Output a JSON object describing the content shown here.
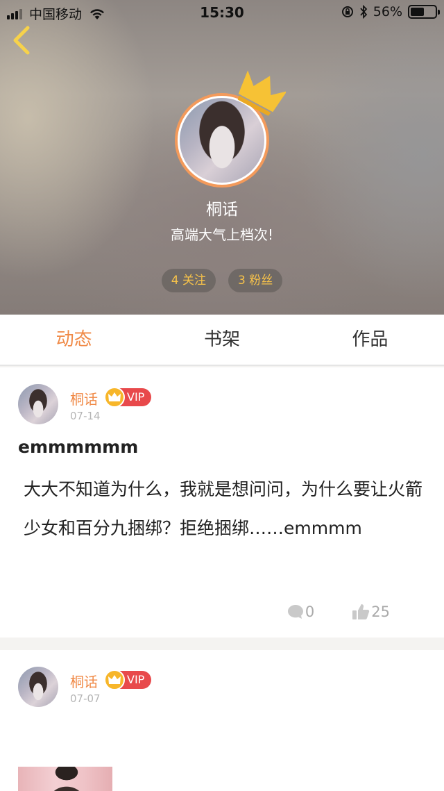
{
  "status_bar": {
    "carrier": "中国移动",
    "time": "15:30",
    "battery_percent": "56%",
    "battery_level": 0.56
  },
  "profile": {
    "username": "桐话",
    "bio": "高端大气上档次!",
    "following": "4 关注",
    "followers": "3 粉丝"
  },
  "tabs": [
    {
      "label": "动态",
      "active": true
    },
    {
      "label": "书架",
      "active": false
    },
    {
      "label": "作品",
      "active": false
    }
  ],
  "posts": [
    {
      "user": "桐话",
      "vip": "VIP",
      "date": "07-14",
      "title": "emmmmmm",
      "body": "大大不知道为什么，我就是想问问，为什么要让火箭少女和百分九捆绑？拒绝捆绑……emmmm",
      "comments": "0",
      "likes": "25"
    },
    {
      "user": "桐话",
      "vip": "VIP",
      "date": "07-07"
    }
  ],
  "colors": {
    "accent": "#f08a47",
    "vip_red": "#e8494b",
    "vip_gold": "#f7b62a",
    "pill_text": "#f7c24a"
  },
  "icons": [
    "back-arrow-icon",
    "crown-icon",
    "comment-icon",
    "thumbs-up-icon",
    "wifi-icon",
    "bluetooth-icon",
    "rotation-lock-icon",
    "battery-icon"
  ]
}
